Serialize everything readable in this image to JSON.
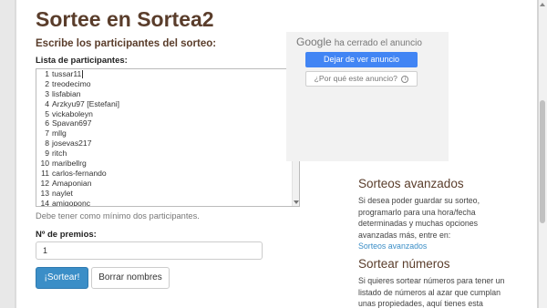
{
  "page": {
    "title": "Sortee en Sortea2",
    "subtitle": "Escribe los participantes del sorteo:",
    "list_label": "Lista de participantes:",
    "participants": [
      {
        "num": "1",
        "name": "tussar11"
      },
      {
        "num": "2",
        "name": "treodecimo"
      },
      {
        "num": "3",
        "name": "lisfabian"
      },
      {
        "num": "4",
        "name": "Arzkyu97 [Estefani]"
      },
      {
        "num": "5",
        "name": "vickaboleyn"
      },
      {
        "num": "6",
        "name": "Spavan697"
      },
      {
        "num": "7",
        "name": "mllg"
      },
      {
        "num": "8",
        "name": "josevas217"
      },
      {
        "num": "9",
        "name": "ritch"
      },
      {
        "num": "10",
        "name": "maribellrg"
      },
      {
        "num": "11",
        "name": "carlos-fernando"
      },
      {
        "num": "12",
        "name": "Amaponian"
      },
      {
        "num": "13",
        "name": "naylet"
      },
      {
        "num": "14",
        "name": "amigoponc"
      }
    ],
    "hint": "Debe tener como mínimo dos participantes.",
    "prizes_label": "Nº de premios:",
    "prizes_value": "1",
    "draw_button": "¡Sortear!",
    "clear_button": "Borrar nombres"
  },
  "ad": {
    "google_label": "Google",
    "closed_text": "ha cerrado el anuncio",
    "stop_button": "Dejar de ver anuncio",
    "why_button": "¿Por qué este anuncio?",
    "info_glyph": "i"
  },
  "sidebar": {
    "advanced_title": "Sorteos avanzados",
    "advanced_text": "Si desea poder guardar su sorteo, programarlo para una hora/fecha determinadas y muchas opciones avanzadas más, entre en:",
    "advanced_link": "Sorteos avanzados",
    "numbers_title": "Sortear números",
    "numbers_text": "Si quieres sortear números para tener un listado de números al azar que cumplan unas propiedades, aquí tienes esta"
  },
  "colors": {
    "heading": "#5a3d2b",
    "primary": "#3b8ec7",
    "google_blue": "#4285f4"
  }
}
